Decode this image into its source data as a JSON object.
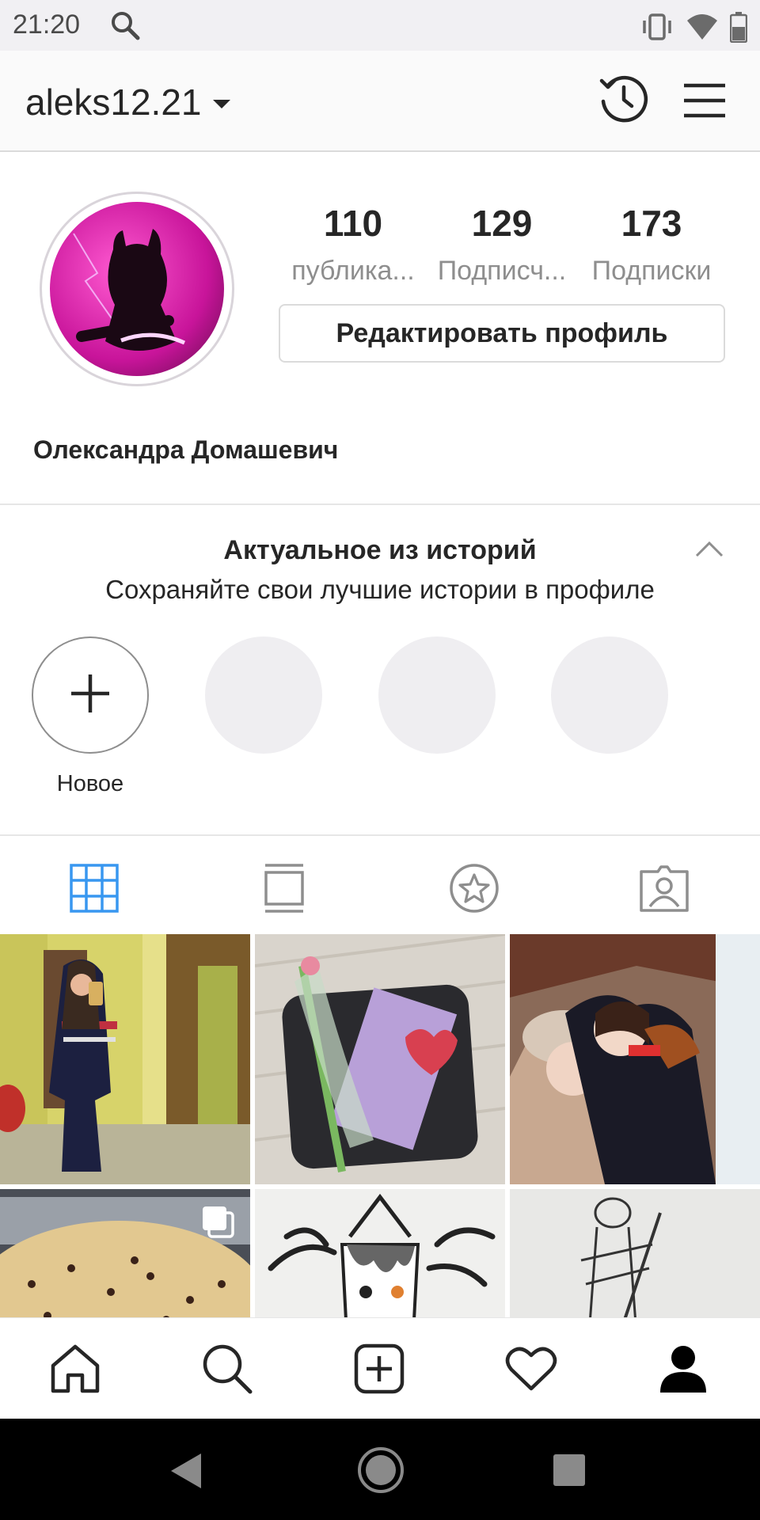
{
  "status_bar": {
    "time": "21:20",
    "icons": [
      "search-icon",
      "vibrate-icon",
      "wifi-icon",
      "battery-icon"
    ]
  },
  "header": {
    "username": "aleks12.21",
    "icons": [
      "chevron-down-icon",
      "history-icon",
      "menu-icon"
    ]
  },
  "profile": {
    "stats": [
      {
        "value": "110",
        "label": "публика..."
      },
      {
        "value": "129",
        "label": "Подписч..."
      },
      {
        "value": "173",
        "label": "Подписки"
      }
    ],
    "edit_button": "Редактировать профиль",
    "full_name": "Олександра Домашевич"
  },
  "highlights": {
    "title": "Актуальное из историй",
    "subtitle": "Сохраняйте свои лучшие истории в профиле",
    "new_label": "Новое"
  },
  "tabs": [
    "grid-icon",
    "feed-icon",
    "saved-star-icon",
    "tagged-icon"
  ],
  "bottom_nav": [
    "home-icon",
    "search-icon",
    "add-post-icon",
    "activity-heart-icon",
    "profile-icon"
  ],
  "colors": {
    "accent_blue": "#3897f0",
    "text": "#262626",
    "secondary": "#8e8e8e",
    "border": "#dbdbdb"
  }
}
